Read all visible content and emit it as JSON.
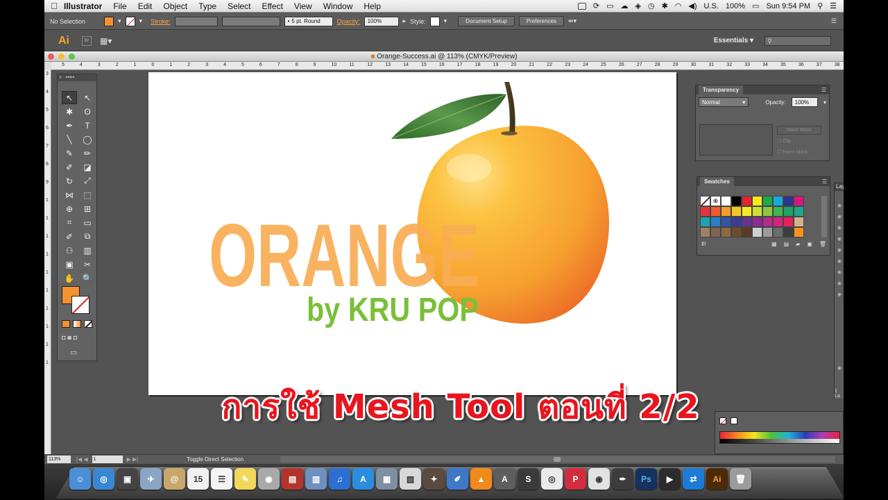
{
  "menubar": {
    "app_name": "Illustrator",
    "items": [
      "File",
      "Edit",
      "Object",
      "Type",
      "Select",
      "Effect",
      "View",
      "Window",
      "Help"
    ],
    "input_source": "U.S.",
    "battery": "100%",
    "clock": "Sun 9:54 PM"
  },
  "controlbar": {
    "selection": "No Selection",
    "stroke_label": "Stroke:",
    "brush": "5 pt. Round",
    "opacity_label": "Opacity:",
    "opacity_value": "100%",
    "style_label": "Style:",
    "document_setup": "Document Setup",
    "preferences": "Preferences"
  },
  "appbar": {
    "ai_logo": "Ai",
    "br_logo": "Br",
    "workspace": "Essentials"
  },
  "document": {
    "title": "Orange-Success.ai @ 113% (CMYK/Preview)"
  },
  "ruler": {
    "h_ticks": [
      "5",
      "4",
      "3",
      "2",
      "1",
      "0",
      "1",
      "2",
      "3",
      "4",
      "5",
      "6",
      "7",
      "8",
      "9",
      "10",
      "11",
      "12",
      "13",
      "14",
      "15",
      "16",
      "17",
      "18",
      "19",
      "20",
      "21",
      "22",
      "23",
      "24",
      "25",
      "26",
      "27",
      "28",
      "29",
      "30",
      "31",
      "32",
      "33",
      "34",
      "35",
      "36",
      "37",
      "38"
    ],
    "v_ticks": [
      "3",
      "4",
      "5",
      "6",
      "7",
      "8",
      "9",
      "1",
      "1",
      "1",
      "1",
      "1",
      "1",
      "1",
      "1",
      "1",
      "1"
    ]
  },
  "artwork": {
    "title_text": "ORANGE",
    "subtitle_text": "by KRU POP",
    "colors": {
      "title": "#f9ac52",
      "subtitle": "#7bbf3a",
      "orange_light": "#fcc240",
      "orange_dark": "#f07a2a",
      "leaf": "#3f7a34",
      "stem": "#4a3a22"
    }
  },
  "tools": {
    "icons": [
      "selection-icon",
      "direct-selection-icon",
      "magic-wand-icon",
      "lasso-icon",
      "pen-icon",
      "type-icon",
      "line-segment-icon",
      "ellipse-icon",
      "paintbrush-icon",
      "pencil-icon",
      "blob-brush-icon",
      "eraser-icon",
      "rotate-icon",
      "scale-icon",
      "width-icon",
      "free-transform-icon",
      "shape-builder-icon",
      "perspective-grid-icon",
      "mesh-icon",
      "gradient-icon",
      "eyedropper-icon",
      "blend-icon",
      "symbol-sprayer-icon",
      "column-graph-icon",
      "artboard-icon",
      "slice-icon",
      "hand-icon",
      "zoom-icon"
    ],
    "glyphs": [
      "↖",
      "↖",
      "✱",
      "ʘ",
      "✒",
      "T",
      "╲",
      "◯",
      "✎",
      "✏",
      "✐",
      "◪",
      "↻",
      "⤢",
      "⋈",
      "⬚",
      "⊕",
      "⊞",
      "⌗",
      "▭",
      "✐",
      "⧉",
      "⚇",
      "▥",
      "▣",
      "✂",
      "✋",
      "🔍"
    ],
    "fill_color": "#f3922f"
  },
  "transparency": {
    "tab": "Transparency",
    "blend_mode": "Normal",
    "opacity_label": "Opacity:",
    "opacity_value": "100%",
    "make_mask": "Make Mask",
    "clip": "Clip",
    "invert_mask": "Invert Mask"
  },
  "swatches": {
    "tab": "Swatches",
    "colors": [
      "none",
      "reg",
      "#ffffff",
      "#000000",
      "#e8222d",
      "#f8e81c",
      "#1fa84b",
      "#1aa9dc",
      "#2d3590",
      "#d6177b",
      "#e8333a",
      "#ee5a2f",
      "#f59a2b",
      "#f7c61f",
      "#f4e92b",
      "#cde135",
      "#8ec63f",
      "#3cb64a",
      "#1ea167",
      "#1fa48f",
      "#1aa3b5",
      "#2b7fc2",
      "#2c56a8",
      "#3b3c93",
      "#633491",
      "#8b2e8f",
      "#b42b8f",
      "#d7217c",
      "#e4205e",
      "#d2b48c",
      "#9d8265",
      "#7c6650",
      "#8d6a3f",
      "#6e4c2b",
      "#5a3b22",
      "#cfcfcf",
      "#9c9c9c",
      "#6d6d6d",
      "#3d3d3d",
      "#f7931e"
    ]
  },
  "layers": {
    "tab": "Lay",
    "count": "1 La"
  },
  "statusbar": {
    "zoom": "113%",
    "artboard": "1",
    "status": "Toggle Direct Selection"
  },
  "caption": {
    "text": "การใช้ Mesh Tool ตอนที่ 2/2"
  },
  "dock": {
    "apps": [
      {
        "name": "finder-icon",
        "bg": "#4a8fd8",
        "glyph": "☺"
      },
      {
        "name": "safari-icon",
        "bg": "#3a87d1",
        "glyph": "◎"
      },
      {
        "name": "photo-booth-icon",
        "bg": "#444",
        "glyph": "▣"
      },
      {
        "name": "preview-icon",
        "bg": "#8aa6c4",
        "glyph": "✈"
      },
      {
        "name": "mail-stamp-icon",
        "bg": "#c9a66b",
        "glyph": "@"
      },
      {
        "name": "calendar-icon",
        "bg": "#f1f1f1",
        "glyph": "15"
      },
      {
        "name": "reminders-icon",
        "bg": "#f4f4f4",
        "glyph": "☰"
      },
      {
        "name": "stickies-icon",
        "bg": "#f1d85b",
        "glyph": "✎"
      },
      {
        "name": "facetime-icon",
        "bg": "#a9a9a9",
        "glyph": "◉"
      },
      {
        "name": "photo-strip-icon",
        "bg": "#b2352b",
        "glyph": "▤"
      },
      {
        "name": "iphoto-icon",
        "bg": "#6f8fbf",
        "glyph": "▥"
      },
      {
        "name": "itunes-icon",
        "bg": "#2a6fd1",
        "glyph": "♫"
      },
      {
        "name": "app-store-icon",
        "bg": "#2a8de0",
        "glyph": "A"
      },
      {
        "name": "image-capture-icon",
        "bg": "#7d8fa1",
        "glyph": "▦"
      },
      {
        "name": "photos-folder-icon",
        "bg": "#d8d8d8",
        "glyph": "▧"
      },
      {
        "name": "photo-tool-icon",
        "bg": "#5b4a3f",
        "glyph": "✦"
      },
      {
        "name": "pixelmator-icon",
        "bg": "#3f78c7",
        "glyph": "✐"
      },
      {
        "name": "vlc-icon",
        "bg": "#f08a1c",
        "glyph": "▲"
      },
      {
        "name": "acrobat-icon",
        "bg": "#5e5e5e",
        "glyph": "A"
      },
      {
        "name": "sbd-icon",
        "bg": "#3a3a3a",
        "glyph": "S"
      },
      {
        "name": "target-icon",
        "bg": "#eaeaea",
        "glyph": "◎"
      },
      {
        "name": "pro-icon",
        "bg": "#d02d3e",
        "glyph": "P"
      },
      {
        "name": "chrome-icon",
        "bg": "#e2e2e2",
        "glyph": "◉"
      },
      {
        "name": "inkscape-icon",
        "bg": "#3c3c3c",
        "glyph": "✒"
      },
      {
        "name": "photoshop-icon",
        "bg": "#16315e",
        "glyph": "Ps"
      },
      {
        "name": "terminal-icon",
        "bg": "#2c2c2c",
        "glyph": "▶"
      },
      {
        "name": "teamviewer-icon",
        "bg": "#1c7bd3",
        "glyph": "⇄"
      },
      {
        "name": "illustrator-icon",
        "bg": "#4a2a08",
        "glyph": "Ai"
      },
      {
        "name": "trash-icon",
        "bg": "#9b9b9b",
        "glyph": "🗑"
      }
    ]
  }
}
